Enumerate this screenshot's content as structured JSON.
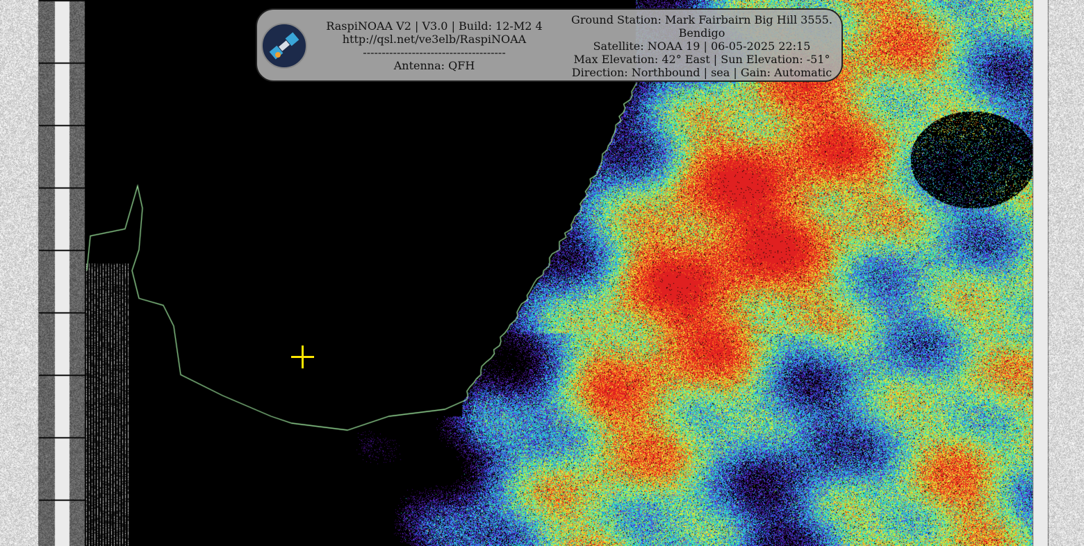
{
  "overlay": {
    "left_lines": [
      "RaspiNOAA V2 | V3.0 | Build: 12-M2 4",
      "http://qsl.net/ve3elb/RaspiNOAA",
      "--------------------------------------",
      "Antenna: QFH"
    ],
    "right_lines": [
      "Ground Station: Mark Fairbairn Big Hill 3555.",
      "Bendigo",
      "Satellite: NOAA 19 | 06-05-2025 22:15",
      "Max Elevation: 42° East | Sun Elevation: -51°",
      "Direction: Northbound | sea | Gain: Automatic"
    ],
    "logo_icon": "satellite-icon"
  },
  "image": {
    "colormap": [
      "#3a0a6e",
      "#5b2bd6",
      "#2a6cf0",
      "#2fd6e6",
      "#30e0a0",
      "#b6f03a",
      "#f5e23a",
      "#ff7a1a",
      "#e02020"
    ],
    "coastline_color": "#9be39b",
    "marker_color": "#ffe600",
    "marker_icon": "crosshair-icon"
  }
}
